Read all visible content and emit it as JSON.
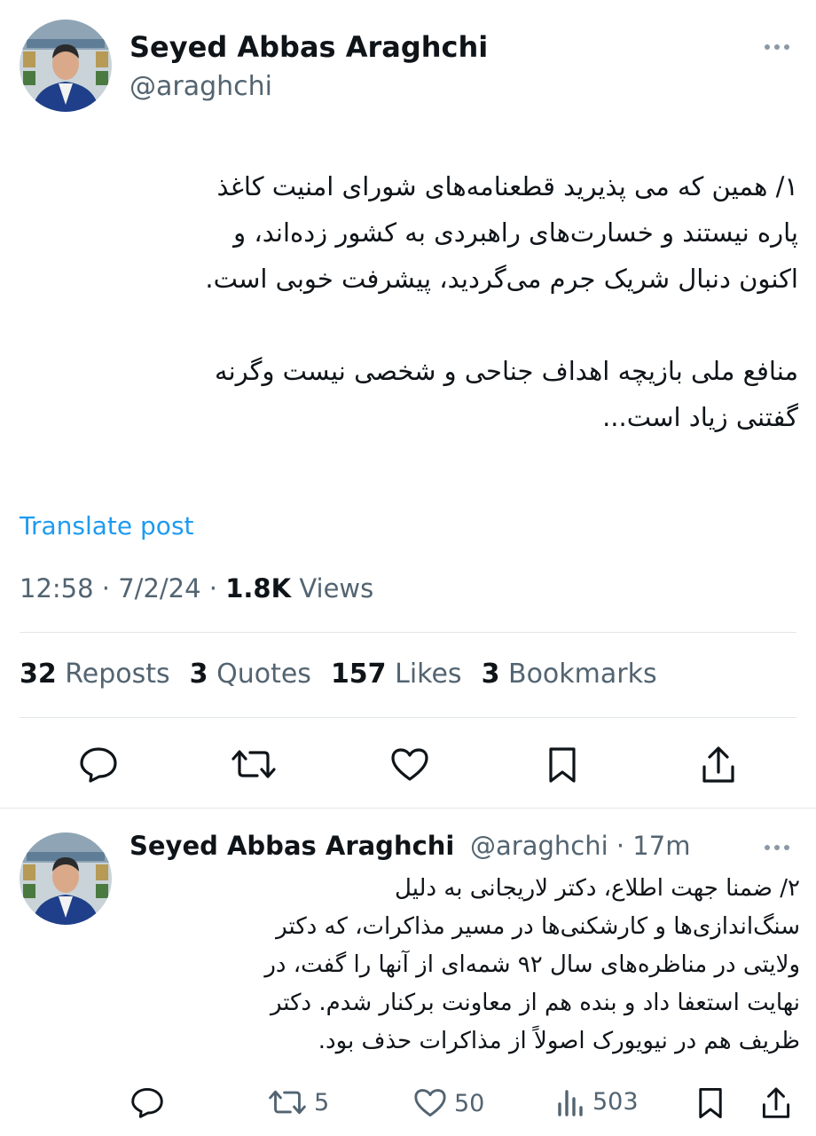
{
  "post1": {
    "author_name": "Seyed Abbas Araghchi",
    "author_handle": "@araghchi",
    "body": "۱/ همین که می پذیرید قطعنامه‌های شورای امنیت کاغذ\nپاره نیستند و خسارت‌های راهبردی به کشور زده‌اند، و\nاکنون دنبال شریک جرم می‌گردید، پیشرفت خوبی است.\n\nمنافع ملی بازیچه اهداف جناحی و شخصی نیست وگرنه\nگفتنی زیاد است...",
    "translate_label": "Translate post",
    "time": "12:58",
    "date": "7/2/24",
    "views_count": "1.8K",
    "views_label": "Views",
    "reposts_count": "32",
    "reposts_label": "Reposts",
    "quotes_count": "3",
    "quotes_label": "Quotes",
    "likes_count": "157",
    "likes_label": "Likes",
    "bookmarks_count": "3",
    "bookmarks_label": "Bookmarks"
  },
  "post2": {
    "author_name": "Seyed Abbas Araghchi",
    "author_handle": "@araghchi",
    "time_ago": "17m",
    "body": "۲/ ضمنا جهت اطلاع، دکتر لاریجانی به دلیل\nسنگ‌اندازی‌ها و کارشکنی‌ها در مسیر مذاکرات، که دکتر\nولایتی در مناظره‌های سال ۹۲ شمه‌ای از آنها را گفت، در\nنهایت استعفا داد و بنده هم از معاونت برکنار شدم. دکتر\nظریف هم در نیویورک اصولاً از مذاکرات حذف بود.",
    "reposts": "5",
    "likes": "50",
    "views": "503"
  },
  "icons": {
    "reply": "reply-icon",
    "repost": "repost-icon",
    "like": "heart-icon",
    "views": "views-icon",
    "bookmark": "bookmark-icon",
    "share": "share-icon",
    "more": "more-icon"
  },
  "colors": {
    "link": "#1d9bf0",
    "secondary_text": "#536471",
    "primary_text": "#0f1419",
    "divider": "#e1e6ea"
  }
}
